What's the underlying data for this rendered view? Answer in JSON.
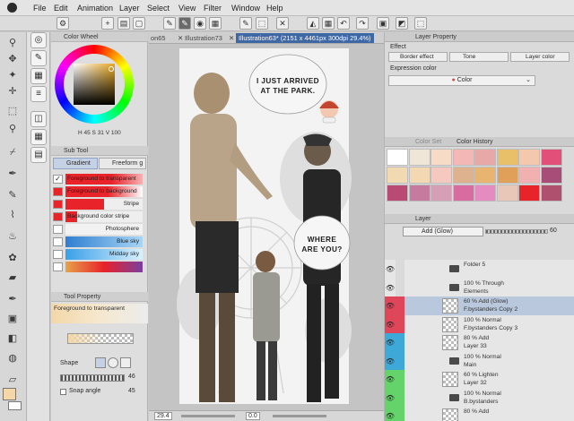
{
  "menu": [
    "File",
    "Edit",
    "Animation",
    "Layer",
    "Select",
    "View",
    "Filter",
    "Window",
    "Help"
  ],
  "doc_tabs": {
    "tab1": "on65",
    "tab2": "Illustration73",
    "tab3": "Illustration63* (2151 x 4461px 300dpi 29.4%)"
  },
  "color_wheel": {
    "title": "Color Wheel",
    "h": "45",
    "s": "31",
    "v": "100"
  },
  "sub_tool": {
    "title": "Sub Tool",
    "tab_gradient": "Gradient",
    "tab_freeform": "Freeform g",
    "items": [
      {
        "label": "Foreground to transparent",
        "color": "#e8232a"
      },
      {
        "label": "Foreground to background",
        "color": "#e8232a"
      },
      {
        "label": "Stripe",
        "color": "#e8232a"
      },
      {
        "label": "Background color stripe",
        "color": "#e8232a"
      },
      {
        "label": "Photosphere",
        "color": "#f2f2f2"
      },
      {
        "label": "Blue sky",
        "color": "#2f7fd0"
      },
      {
        "label": "Midday sky",
        "color": "#39a0e8"
      },
      {
        "label": "",
        "color": "#e7a24a"
      }
    ]
  },
  "tool_property": {
    "title": "Tool Property",
    "tool_name": "Foreground to transparent",
    "shape_label": "Shape",
    "snap_label": "Snap angle",
    "value_1": "46",
    "value_2": "45"
  },
  "layer_property": {
    "title": "Layer Property",
    "effect_label": "Effect",
    "border_effect": "Border effect",
    "tone": "Tone",
    "layer_color": "Layer color",
    "expression_label": "Expression color",
    "expression_value": "Color"
  },
  "color_history": {
    "tab_color_set": "Color Set",
    "tab_history": "Color History",
    "swatches": [
      "#ffffff",
      "#f0e6d8",
      "#f6dcc6",
      "#f3b7b5",
      "#e8a8a8",
      "#e8c06a",
      "#f3c8ad",
      "#e24f79",
      "#f1d9b1",
      "#f4d8b3",
      "#f5c9c0",
      "#dfb28f",
      "#e8b570",
      "#e0a05a",
      "#f2b0b0",
      "#a84d78",
      "#b84a74",
      "#c57a9e",
      "#d79fb6",
      "#d86ca0",
      "#e48cc0",
      "#e8c7b8",
      "#e8232a",
      "#b0506f"
    ]
  },
  "layer_panel": {
    "title": "Layer",
    "blend_mode": "Add (Glow)",
    "opacity": "60",
    "layers": [
      {
        "line1": "Folder 5",
        "line2": "",
        "tag": "#dadada",
        "kind": "folder"
      },
      {
        "line1": "100 % Through",
        "line2": "Elements",
        "tag": "#dadada",
        "kind": "folder"
      },
      {
        "line1": "60 % Add (Glow)",
        "line2": "F.bystanders Copy 2",
        "tag": "#e0465a",
        "kind": "layer"
      },
      {
        "line1": "100 % Normal",
        "line2": "F.bystanders Copy 3",
        "tag": "#e0465a",
        "kind": "layer"
      },
      {
        "line1": "80 % Add",
        "line2": "Layer 33",
        "tag": "#3ea8d8",
        "kind": "layer"
      },
      {
        "line1": "100 % Normal",
        "line2": "Main",
        "tag": "#3ea8d8",
        "kind": "folder"
      },
      {
        "line1": "60 % Lighten",
        "line2": "Layer 32",
        "tag": "#63d36a",
        "kind": "layer"
      },
      {
        "line1": "100 % Normal",
        "line2": "B.bystanders",
        "tag": "#63d36a",
        "kind": "folder"
      },
      {
        "line1": "80 % Add",
        "line2": "",
        "tag": "#63d36a",
        "kind": "layer"
      }
    ]
  },
  "canvas": {
    "bubble1": [
      "I JUST ARRIVED",
      "AT THE PARK."
    ],
    "bubble2": [
      "WHERE",
      "ARE YOU?"
    ]
  },
  "status": {
    "zoom": "29.4",
    "angle": "0.0"
  },
  "colors": {
    "accent": "#3e67a6",
    "selected_layer": "#b9c8dc",
    "main_color": "#f3d7a8"
  }
}
